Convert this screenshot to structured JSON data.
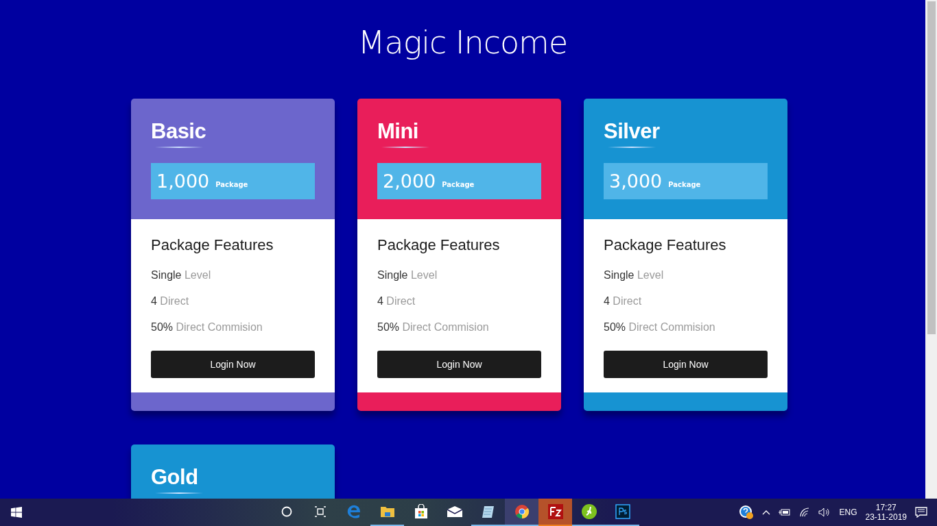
{
  "page": {
    "title": "Magic Income"
  },
  "plans": [
    {
      "name": "Basic",
      "color": "#6c66cc",
      "price": "1,000",
      "price_unit": "Package",
      "features_title": "Package Features",
      "features": [
        "**Single** Level",
        "**4** Direct",
        "**50%** Direct Commision"
      ],
      "button": "Login Now"
    },
    {
      "name": "Mini",
      "color": "#e91e5a",
      "price": "2,000",
      "price_unit": "Package",
      "features_title": "Package Features",
      "features": [
        "**Single** Level",
        "**4** Direct",
        "**50%** Direct Commision"
      ],
      "button": "Login Now"
    },
    {
      "name": "Silver",
      "color": "#1793d2",
      "price": "3,000",
      "price_unit": "Package",
      "features_title": "Package Features",
      "features": [
        "**Single** Level",
        "**4** Direct",
        "**50%** Direct Commision"
      ],
      "button": "Login Now"
    },
    {
      "name": "Gold",
      "color": "#1793d2"
    }
  ],
  "taskbar": {
    "apps": [
      {
        "kind": "cortana",
        "running": false,
        "selected": false,
        "flashing": false
      },
      {
        "kind": "taskview",
        "running": false,
        "selected": false,
        "flashing": false
      },
      {
        "kind": "edge",
        "running": false,
        "selected": false,
        "flashing": false
      },
      {
        "kind": "explorer",
        "running": true,
        "selected": false,
        "flashing": false
      },
      {
        "kind": "store",
        "running": false,
        "selected": false,
        "flashing": false
      },
      {
        "kind": "mail",
        "running": false,
        "selected": false,
        "flashing": false
      },
      {
        "kind": "notepad",
        "running": true,
        "selected": false,
        "flashing": false
      },
      {
        "kind": "chrome",
        "running": true,
        "selected": true,
        "flashing": false
      },
      {
        "kind": "filezilla",
        "running": true,
        "selected": false,
        "flashing": true
      },
      {
        "kind": "dreamweaver",
        "running": true,
        "selected": false,
        "flashing": false
      },
      {
        "kind": "photoshop",
        "running": true,
        "selected": false,
        "flashing": false
      }
    ],
    "language": "ENG",
    "time": "17:27",
    "date": "23-11-2019"
  }
}
